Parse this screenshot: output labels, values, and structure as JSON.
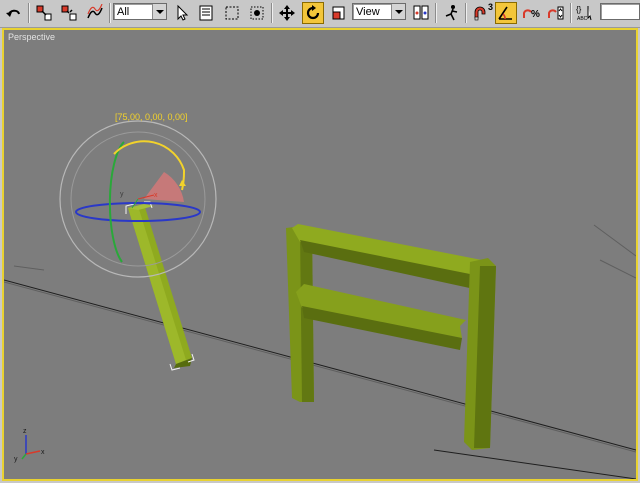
{
  "toolbar": {
    "selection_filter": "All",
    "reference_coord_system": "View",
    "angle_snap_value": "3"
  },
  "viewport": {
    "label": "Perspective",
    "gizmo_readout": "[75,00, 0,00, 0,00]",
    "axis_tripod": {
      "x": "x",
      "y": "y",
      "z": "z"
    },
    "gizmo_axis_labels": {
      "x": "x",
      "y": "y"
    }
  },
  "colors": {
    "viewport_bg": "#7d7d7d",
    "active_border": "#e8d231",
    "object_green": "#8aa41c",
    "gizmo_yellow": "#f2d22b",
    "gizmo_blue": "#2a38c8",
    "gizmo_green": "#2aa83a",
    "gizmo_red": "#d83a2a"
  }
}
